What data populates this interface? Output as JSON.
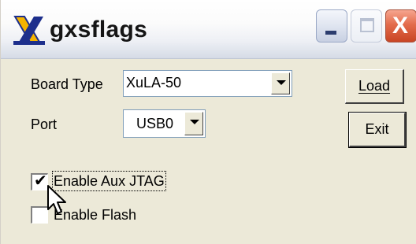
{
  "window": {
    "title": "gxsflags",
    "icons": {
      "app": "xilinx-x-logo",
      "minimize": "minimize-icon",
      "maximize": "maximize-icon",
      "close": "close-icon"
    },
    "close_glyph": "X"
  },
  "form": {
    "board_type": {
      "label": "Board Type",
      "selected": "XuLA-50"
    },
    "port": {
      "label": "Port",
      "selected": "USB0"
    },
    "enable_aux_jtag": {
      "label": "Enable Aux JTAG",
      "checked": true,
      "check_glyph": "✔"
    },
    "enable_flash": {
      "label": "Enable Flash",
      "checked": false
    }
  },
  "buttons": {
    "load": "Load",
    "exit": "Exit"
  },
  "colors": {
    "logo_gold": "#f5b400",
    "logo_navy": "#1d2f8c",
    "close_red": "#d9542f"
  }
}
